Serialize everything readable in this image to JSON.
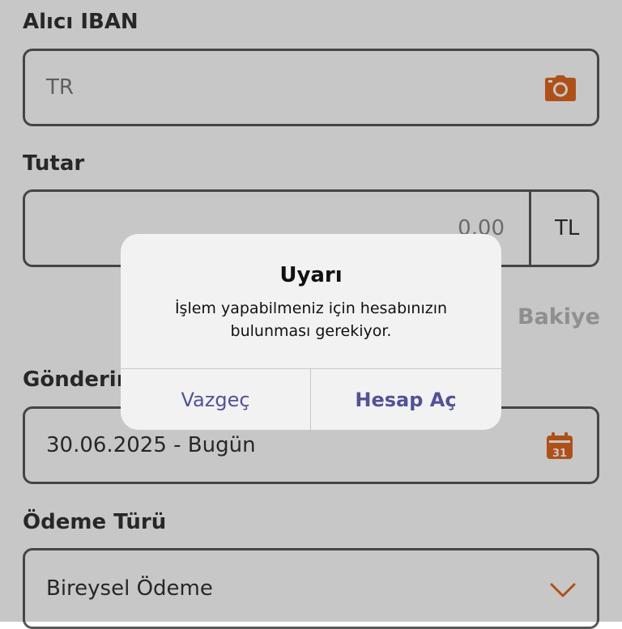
{
  "form": {
    "iban": {
      "label": "Alıcı IBAN",
      "placeholder": "TR",
      "camera_icon": "camera-icon"
    },
    "amount": {
      "label": "Tutar",
      "value": "0,00",
      "currency": "TL",
      "balance_link": "Bakiye"
    },
    "send_date": {
      "label": "Gönderim",
      "value": "30.06.2025 - Bugün",
      "calendar_day": "31"
    },
    "payment_type": {
      "label": "Ödeme Türü",
      "value": "Bireysel Ödeme"
    }
  },
  "alert": {
    "title": "Uyarı",
    "message_line1": "İşlem yapabilmeniz için hesabınızın",
    "message_line2": "bulunması gerekiyor.",
    "cancel_label": "Vazgeç",
    "confirm_label": "Hesap Aç"
  },
  "colors": {
    "accent": "#e0671f",
    "alert_button_text": "#525297",
    "overlay": "rgba(0,0,0,0.22)"
  }
}
